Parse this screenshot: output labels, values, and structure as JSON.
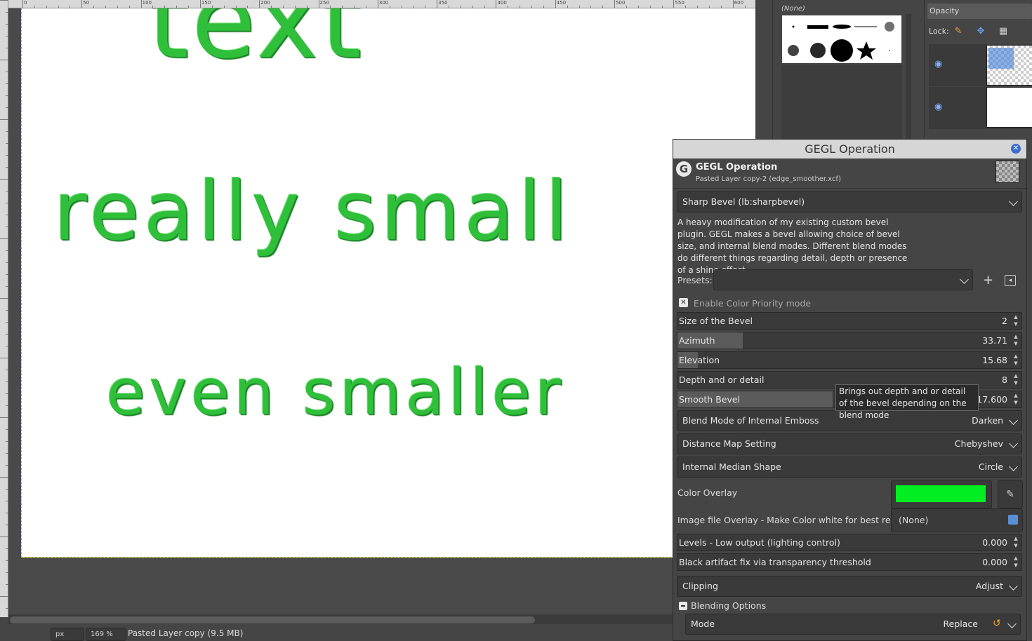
{
  "ruler": {
    "top_ticks": [
      "0",
      "50",
      "100",
      "150",
      "200",
      "250",
      "300",
      "350",
      "400",
      "450",
      "500",
      "550",
      "600"
    ]
  },
  "canvas": {
    "texts": [
      "text",
      "really small",
      "even smaller"
    ]
  },
  "statusbar": {
    "unit": "px",
    "zoom": "169 %",
    "status": "Pasted Layer copy (9.5 MB)"
  },
  "brushes": {
    "selected_name": "(None)"
  },
  "layers": {
    "opacity_label": "Opacity",
    "lock_label": "Lock:"
  },
  "dialog": {
    "window_title": "GEGL Operation",
    "header_title": "GEGL Operation",
    "header_subtitle": "Pasted Layer copy-2 (edge_smoother.xcf)",
    "operation": "Sharp Bevel (lb:sharpbevel)",
    "description": "A heavy modification of my existing custom bevel plugin. GEGL makes a bevel allowing choice of bevel size, and internal blend modes.  Different blend modes do different things regarding detail, depth or presence of a shine effect.",
    "presets_label": "Presets:",
    "color_priority_label": "Enable Color Priority mode",
    "params": [
      {
        "label": "Size of the Bevel",
        "value": "2",
        "fill": 0.0
      },
      {
        "label": "Azimuth",
        "value": "33.71",
        "fill": 0.19
      },
      {
        "label": "Elevation",
        "value": "15.68",
        "fill": 0.06
      },
      {
        "label": "Depth and or detail",
        "value": "8",
        "fill": 0.0
      },
      {
        "label": "Smooth Bevel",
        "value": "17.600",
        "fill": 0.45
      }
    ],
    "tooltip": "Brings out depth and or detail of the bevel depending on the blend mode",
    "blend_mode_label": "Blend Mode of Internal Emboss",
    "blend_mode_value": "Darken",
    "distance_map_label": "Distance Map Setting",
    "distance_map_value": "Chebyshev",
    "median_shape_label": "Internal Median Shape",
    "median_shape_value": "Circle",
    "color_overlay_label": "Color Overlay",
    "color_overlay_value": "#00ee22",
    "image_overlay_label": "Image file Overlay - Make Color white for best results.",
    "image_overlay_value": "(None)",
    "levels_label": "Levels - Low output (lighting control)",
    "levels_value": "0.000",
    "black_fix_label": "Black artifact fix via transparency threshold",
    "black_fix_value": "0.000",
    "clipping_label": "Clipping",
    "clipping_value": "Adjust",
    "blending_options_label": "Blending Options",
    "mode_label": "Mode",
    "mode_value": "Replace"
  }
}
